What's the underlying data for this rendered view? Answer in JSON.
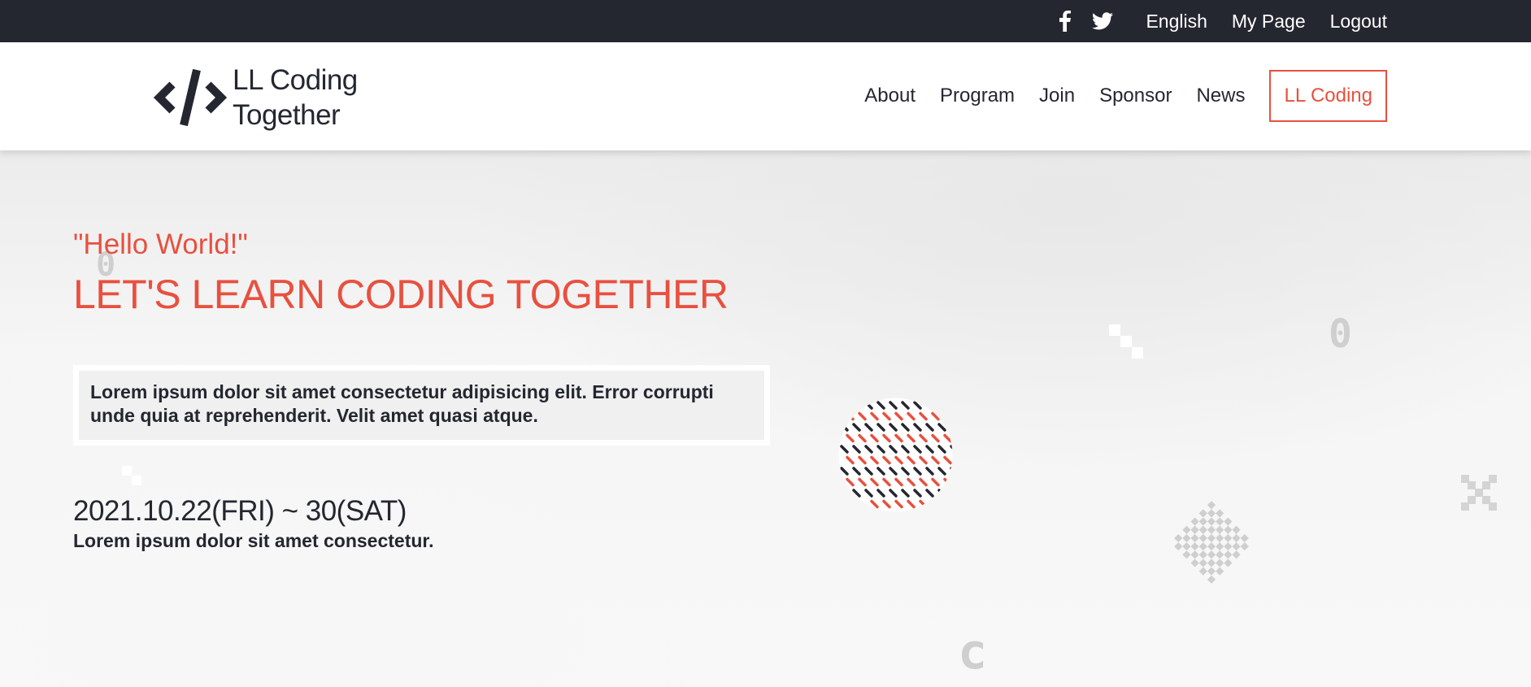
{
  "topbar": {
    "social_icons": [
      "facebook-icon",
      "twitter-icon"
    ],
    "language": "English",
    "my_page": "My Page",
    "logout": "Logout"
  },
  "brand": {
    "icon": "code-brackets-icon",
    "line1": "LL Coding",
    "line2": "Together"
  },
  "nav": {
    "items": [
      "About",
      "Program",
      "Join",
      "Sponsor",
      "News"
    ],
    "cta": "LL Coding"
  },
  "hero": {
    "greeting": "\"Hello World!\"",
    "headline": "LET'S LEARN CODING TOGETHER",
    "description": "Lorem ipsum dolor sit amet consectetur adipisicing elit. Error corrupti unde quia at reprehenderit. Velit amet quasi atque.",
    "date": "2021.10.22(FRI) ~ 30(SAT)",
    "subtext": "Lorem ipsum dolor sit amet consectetur."
  },
  "colors": {
    "accent": "#e8503f",
    "dark": "#242730",
    "background": "#f4f4f4"
  },
  "decorations": {
    "glyphs": [
      "0",
      "0",
      "c"
    ]
  }
}
